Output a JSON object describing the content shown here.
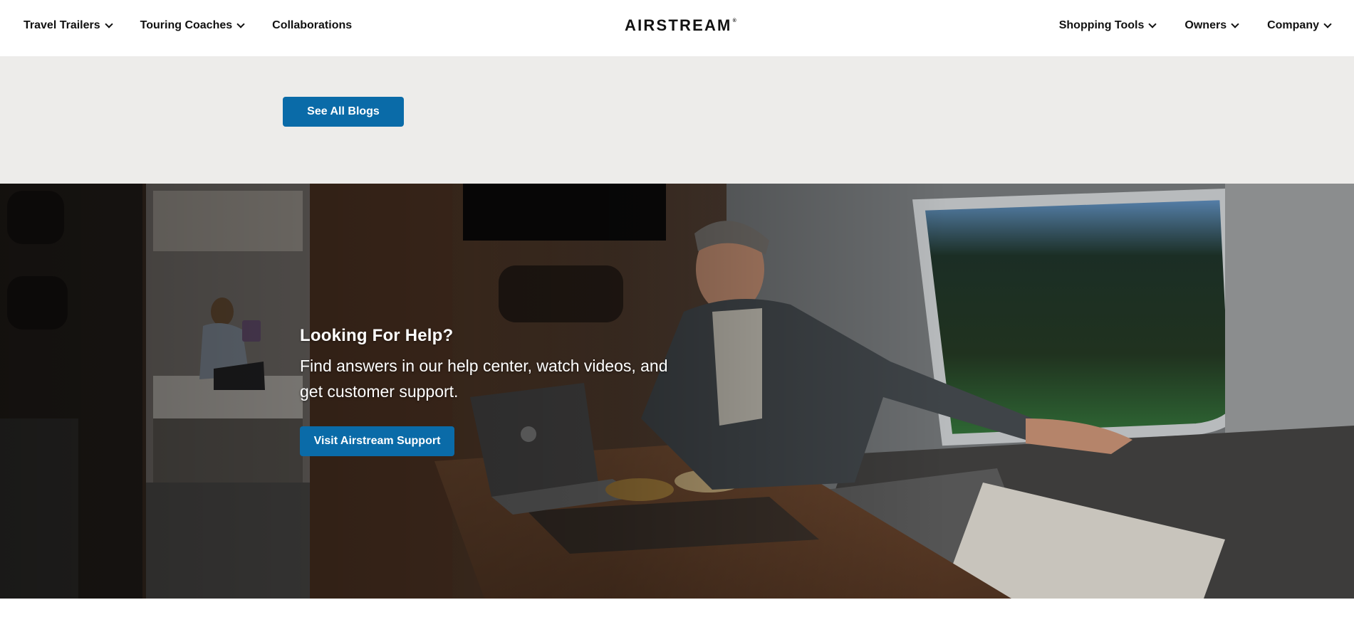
{
  "header": {
    "logo": "AIRSTREAM",
    "logo_mark": "®",
    "nav_left": [
      {
        "label": "Travel Trailers",
        "has_dropdown": true
      },
      {
        "label": "Touring Coaches",
        "has_dropdown": true
      },
      {
        "label": "Collaborations",
        "has_dropdown": false
      }
    ],
    "nav_right": [
      {
        "label": "Shopping Tools",
        "has_dropdown": true
      },
      {
        "label": "Owners",
        "has_dropdown": true
      },
      {
        "label": "Company",
        "has_dropdown": true
      }
    ]
  },
  "blogs": {
    "button_label": "See All Blogs"
  },
  "help": {
    "title": "Looking For Help?",
    "description": "Find answers in our help center, watch videos, and get customer support.",
    "button_label": "Visit Airstream Support"
  },
  "colors": {
    "accent_blue": "#0a6ba8",
    "grey_band": "#edecea",
    "text_dark": "#111111"
  }
}
